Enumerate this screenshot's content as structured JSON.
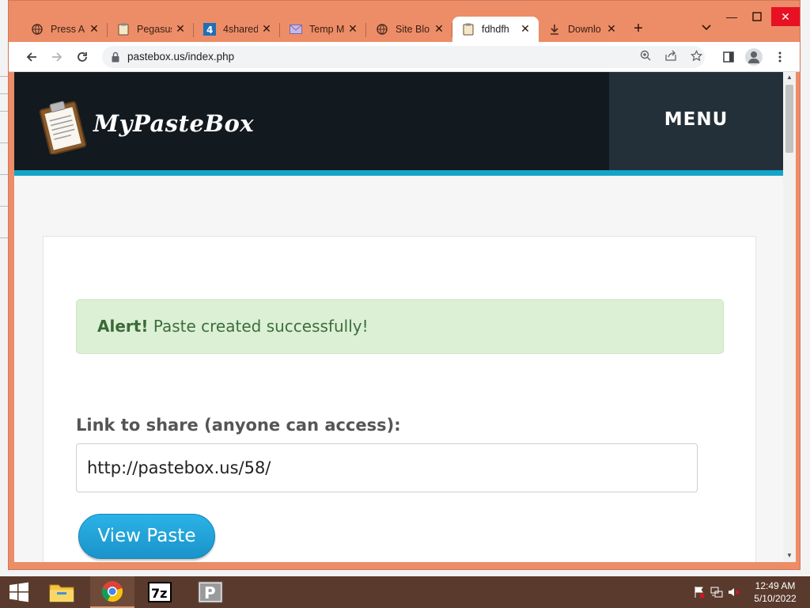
{
  "browser": {
    "tabs": [
      {
        "title": "Press Al",
        "icon": "globe-icon"
      },
      {
        "title": "Pegasus",
        "icon": "clipboard-icon"
      },
      {
        "title": "4shared",
        "icon": "4shared-icon"
      },
      {
        "title": "Temp M",
        "icon": "mail-icon"
      },
      {
        "title": "Site Blo",
        "icon": "globe-icon"
      },
      {
        "title": "fdhdfh",
        "icon": "clipboard-icon",
        "active": true
      },
      {
        "title": "Downlo",
        "icon": "download-icon"
      }
    ],
    "url": "pastebox.us/index.php",
    "accent_color": "#ec8d68"
  },
  "site": {
    "logo_text": "MyPasteBox",
    "menu_label": "MENU",
    "alert_strong": "Alert!",
    "alert_message": "Paste created successfully!",
    "link_label": "Link to share (anyone can access):",
    "share_link": "http://pastebox.us/58/",
    "view_button": "View Paste",
    "colors": {
      "header": "#121a20",
      "accent_bar": "#13a4c8",
      "alert_bg": "#dcf0d5",
      "button": "#1fa3d8"
    }
  },
  "taskbar": {
    "items": [
      "file-explorer-icon",
      "chrome-icon",
      "7zip-icon",
      "pastebox-app-icon"
    ],
    "time": "12:49 AM",
    "date": "5/10/2022"
  }
}
